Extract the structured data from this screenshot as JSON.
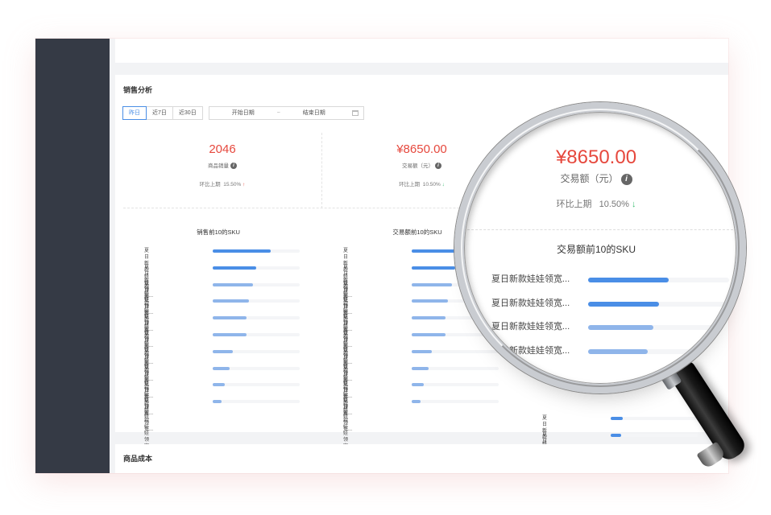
{
  "sales": {
    "title": "销售分析",
    "tabs": [
      "昨日",
      "近7日",
      "近30日"
    ],
    "date_start": "开始日期",
    "date_sep": "~",
    "date_end": "结束日期",
    "stats": [
      {
        "value": "2046",
        "label": "商品销量",
        "change_label": "环比上期",
        "change": "15.50%",
        "direction": "up"
      },
      {
        "value": "¥8650.00",
        "label": "交易额（元）",
        "change_label": "环比上期",
        "change": "10.50%",
        "direction": "down"
      }
    ],
    "rankings": [
      {
        "title": "销售前10的SKU",
        "item_label": "夏日新款娃娃领宽...",
        "values": [
          0.67,
          0.5,
          0.46,
          0.42,
          0.39,
          0.39,
          0.23,
          0.19,
          0.14,
          0.1
        ]
      },
      {
        "title": "交易额前10的SKU",
        "item_label": "夏日新款娃娃领宽...",
        "values": [
          0.57,
          0.5,
          0.46,
          0.42,
          0.39,
          0.39,
          0.23,
          0.19,
          0.14,
          0.1
        ]
      },
      {
        "title": "",
        "item_label": "夏日新款娃娃领宽...",
        "values": [
          0.14,
          0.12
        ]
      }
    ]
  },
  "cost": {
    "title": "商品成本"
  },
  "colors": {
    "accent": "#4a8ee6",
    "value_red": "#e6483d",
    "up": "#e6483d",
    "down": "#3bbf72",
    "sidebar": "#353a45"
  },
  "icons": {
    "info": "info-circle-icon",
    "calendar": "calendar-icon",
    "up": "arrow-up-icon",
    "down": "arrow-down-icon"
  }
}
